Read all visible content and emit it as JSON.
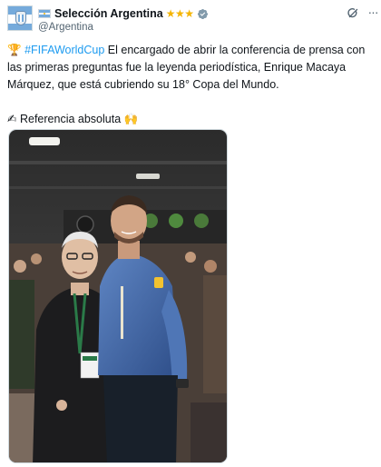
{
  "account": {
    "display_name": "Selección Argentina",
    "stars": "★★★",
    "handle": "@Argentina"
  },
  "icons": {
    "avatar": "argentina-afa-crest-icon",
    "flag": "argentina-flag-icon",
    "verified": "verified-badge-icon",
    "grok": "grok-icon",
    "more": "more-options-icon",
    "trophy": "trophy-emoji",
    "writing_hand": "writing-hand-emoji",
    "raising_hands": "raising-hands-emoji"
  },
  "tweet": {
    "trophy": "🏆",
    "hashtag": "#FIFAWorldCup",
    "body": "El encargado de abrir la conferencia de prensa con las primeras preguntas fue la leyenda periodística, Enrique Macaya Márquez, que está cubriendo su 18° Copa del Mundo.",
    "writing_hand": "✍",
    "line2": "Referencia absoluta",
    "raising_hands": "🙌"
  },
  "colors": {
    "link": "#1d9bf0",
    "text": "#0f1419",
    "secondary": "#536471",
    "verified": "#829aab",
    "star": "#f4b400",
    "argentina_blue": "#75aadb"
  }
}
